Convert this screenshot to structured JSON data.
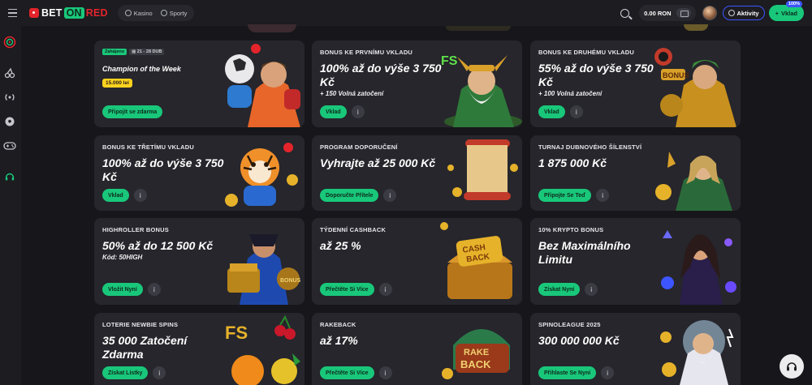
{
  "brand": {
    "part1": "BET",
    "part2": "ON",
    "part3": "RED"
  },
  "nav": {
    "casino": "Kasino",
    "sports": "Sporty"
  },
  "header": {
    "balance": "0.00 RON",
    "activity_label": "Aktivity",
    "deposit_label": "Vklad",
    "deposit_badge": "100%"
  },
  "sidebar_icons": [
    "dartboard-icon",
    "cherries-icon",
    "live-signal-icon",
    "football-icon",
    "gamepad-icon",
    "support-headset-icon"
  ],
  "colors": {
    "accent_green": "#19c77a",
    "accent_blue": "#3d55ff",
    "brand_red": "#e4242b",
    "card_bg": "#26262c"
  },
  "cards": [
    {
      "tag_status": "Zahájeno",
      "tag_dates": "21 - 28 DUB",
      "title": "Champion of the Week",
      "amount": "15.000 lei",
      "cta": "Připojit se zdarma"
    },
    {
      "subtitle": "BONUS KE PRVNÍMU VKLADU",
      "headline": "100% až do výše 3 750 Kč",
      "extra": "+ 150 Volná zatočení",
      "cta": "Vklad"
    },
    {
      "subtitle": "BONUS KE DRUHÉMU VKLADU",
      "headline": "55% až do výše 3 750 Kč",
      "extra": "+ 100 Volná zatočení",
      "cta": "Vklad"
    },
    {
      "subtitle": "BONUS KE TŘETÍMU VKLADU",
      "headline": "100% až do výše 3 750 Kč",
      "cta": "Vklad"
    },
    {
      "subtitle": "PROGRAM DOPORUČENÍ",
      "headline": "Vyhrajte až 25 000 Kč",
      "cta": "Doporučte Přítele"
    },
    {
      "subtitle": "TURNAJ DUBNOVÉHO ŠÍLENSTVÍ",
      "headline": "1 875 000 Kč",
      "cta": "Připojte Se Teď"
    },
    {
      "subtitle": "HIGHROLLER BONUS",
      "headline": "50% až do 12 500 Kč",
      "extra": "Kód: 50HIGH",
      "cta": "Vložit Nyní"
    },
    {
      "subtitle": "TÝDENNÍ CASHBACK",
      "headline": "až 25 %",
      "cta": "Přečtěte Si Více"
    },
    {
      "subtitle": "10% KRYPTO BONUS",
      "headline": "Bez Maximálního Limitu",
      "cta": "Získat Nyní"
    },
    {
      "subtitle": "LOTERIE NEWBIE SPINS",
      "headline": "35 000 Zatočení Zdarma",
      "cta": "Získat Lístky"
    },
    {
      "subtitle": "RAKEBACK",
      "headline": "až 17%",
      "cta": "Přečtěte Si Více"
    },
    {
      "subtitle": "SPINOLEAGUE 2025",
      "headline": "300 000 000 Kč",
      "cta": "Přihlaste Se Nyní"
    }
  ],
  "art_text": {
    "fs": "FS",
    "bonus": "BONUS",
    "cash": "CASH",
    "back": "BACK",
    "rake": "RAKE",
    "rake_back": "BACK"
  }
}
